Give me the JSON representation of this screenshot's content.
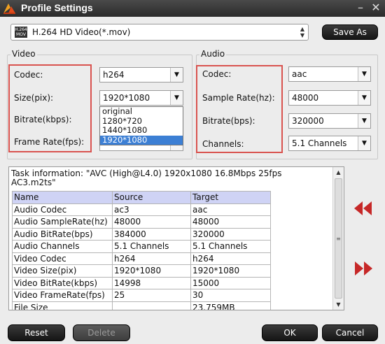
{
  "window": {
    "title": "Profile Settings",
    "minimize_glyph": "–",
    "close_glyph": "✕"
  },
  "format": {
    "icon_text_top": "H.264",
    "icon_text_bottom": "MOV",
    "value": "H.264 HD Video(*.mov)"
  },
  "buttons": {
    "save_as": "Save As",
    "reset": "Reset",
    "delete": "Delete",
    "ok": "OK",
    "cancel": "Cancel"
  },
  "video": {
    "title": "Video",
    "codec_label": "Codec:",
    "codec_value": "h264",
    "size_label": "Size(pix):",
    "size_value": "1920*1080",
    "bitrate_label": "Bitrate(kbps):",
    "framerate_label": "Frame Rate(fps):",
    "size_options": [
      "original",
      "1280*720",
      "1440*1080",
      "1920*1080"
    ]
  },
  "audio": {
    "title": "Audio",
    "codec_label": "Codec:",
    "codec_value": "aac",
    "samplerate_label": "Sample Rate(hz):",
    "samplerate_value": "48000",
    "bitrate_label": "Bitrate(bps):",
    "bitrate_value": "320000",
    "channels_label": "Channels:",
    "channels_value": "5.1 Channels"
  },
  "task": {
    "info_line1": "Task information: \"AVC (High@L4.0) 1920x1080 16.8Mbps 25fps",
    "info_line2": "AC3.m2ts\"",
    "headers": [
      "Name",
      "Source",
      "Target"
    ],
    "rows": [
      [
        "Audio Codec",
        "ac3",
        "aac"
      ],
      [
        "Audio SampleRate(hz)",
        "48000",
        "48000"
      ],
      [
        "Audio BitRate(bps)",
        "384000",
        "320000"
      ],
      [
        "Audio Channels",
        "5.1 Channels",
        "5.1 Channels"
      ],
      [
        "Video Codec",
        "h264",
        "h264"
      ],
      [
        "Video Size(pix)",
        "1920*1080",
        "1920*1080"
      ],
      [
        "Video BitRate(kbps)",
        "14998",
        "15000"
      ],
      [
        "Video FrameRate(fps)",
        "25",
        "30"
      ],
      [
        "File Size",
        "",
        "23.759MB"
      ]
    ]
  },
  "colors": {
    "accent_red": "#c62828",
    "highlight_box": "#d9534f",
    "selection_blue": "#3c7fd4",
    "table_header": "#cfd3f5"
  }
}
